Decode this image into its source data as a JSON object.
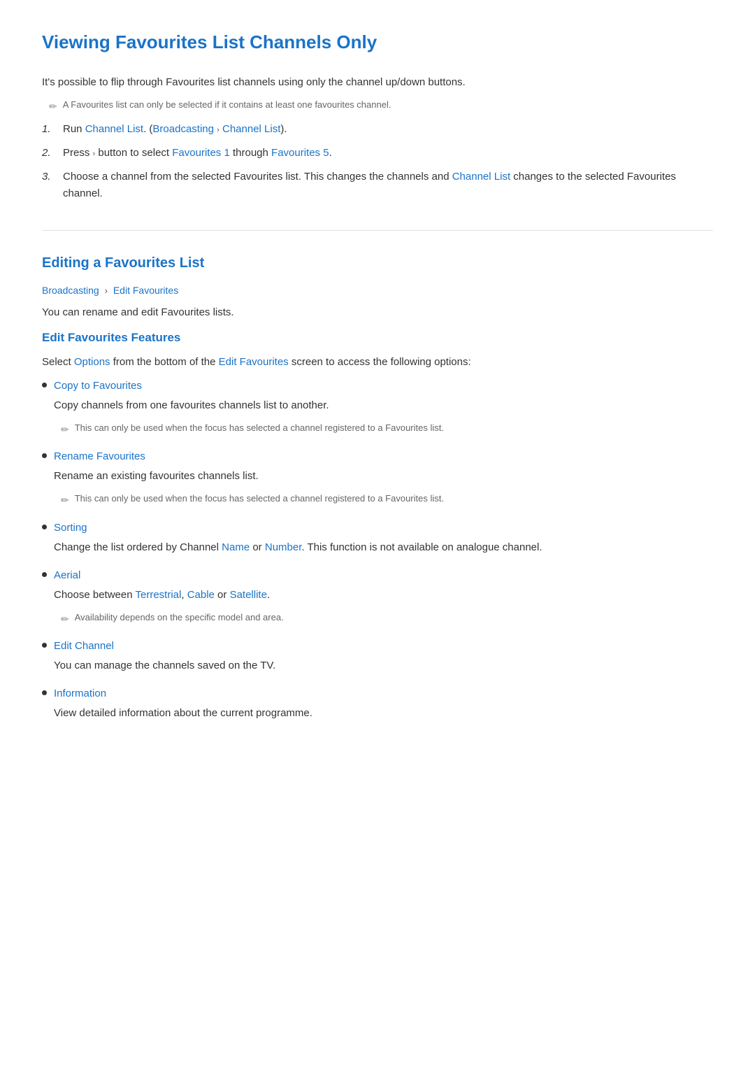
{
  "section1": {
    "heading": "Viewing Favourites List Channels Only",
    "intro": "It's possible to flip through Favourites list channels using only the channel up/down buttons.",
    "note1": "A Favourites list can only be selected if it contains at least one favourites channel.",
    "steps": [
      {
        "num": "1.",
        "text_before": "Run ",
        "link1": "Channel List",
        "text_mid1": ". (",
        "link2": "Broadcasting",
        "text_mid2": " › ",
        "link3": "Channel List",
        "text_after": ")."
      },
      {
        "num": "2.",
        "text_before": "Press › button to select ",
        "link1": "Favourites 1",
        "text_mid": " through ",
        "link2": "Favourites 5",
        "text_after": "."
      },
      {
        "num": "3.",
        "text_before": "Choose a channel from the selected Favourites list. This changes the channels and ",
        "link1": "Channel List",
        "text_after": " changes to the selected Favourites channel."
      }
    ]
  },
  "section2": {
    "heading": "Editing a Favourites List",
    "breadcrumb_part1": "Broadcasting",
    "breadcrumb_part2": "Edit Favourites",
    "intro": "You can rename and edit Favourites lists.",
    "subsection": {
      "heading": "Edit Favourites Features",
      "intro_before": "Select ",
      "intro_link1": "Options",
      "intro_mid": " from the bottom of the ",
      "intro_link2": "Edit Favourites",
      "intro_after": " screen to access the following options:",
      "items": [
        {
          "title": "Copy to Favourites",
          "body": "Copy channels from one favourites channels list to another.",
          "note": "This can only be used when the focus has selected a channel registered to a Favourites list."
        },
        {
          "title": "Rename Favourites",
          "body": "Rename an existing favourites channels list.",
          "note": "This can only be used when the focus has selected a channel registered to a Favourites list."
        },
        {
          "title": "Sorting",
          "body_before": "Change the list ordered by Channel ",
          "body_link1": "Name",
          "body_mid": " or ",
          "body_link2": "Number",
          "body_after": ". This function is not available on analogue channel.",
          "note": null
        },
        {
          "title": "Aerial",
          "body_before": "Choose between ",
          "body_link1": "Terrestrial",
          "body_mid1": ", ",
          "body_link2": "Cable",
          "body_mid2": " or ",
          "body_link3": "Satellite",
          "body_after": ".",
          "note": "Availability depends on the specific model and area."
        },
        {
          "title": "Edit Channel",
          "body": "You can manage the channels saved on the TV.",
          "note": null
        },
        {
          "title": "Information",
          "body": "View detailed information about the current programme.",
          "note": null
        }
      ]
    }
  }
}
